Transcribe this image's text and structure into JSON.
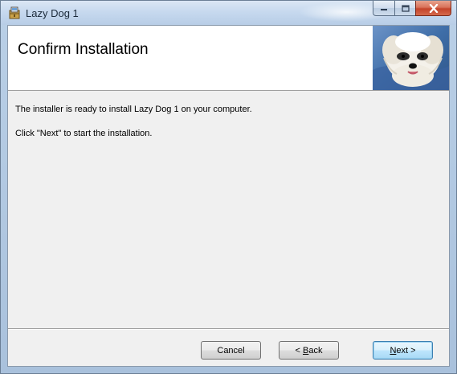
{
  "window": {
    "title": "Lazy Dog 1"
  },
  "caption_buttons": {
    "minimize_icon": "minimize-icon",
    "maximize_icon": "maximize-icon",
    "close_icon": "close-icon"
  },
  "banner": {
    "title": "Confirm Installation",
    "image": "dog-illustration"
  },
  "body": {
    "line1": "The installer is ready to install Lazy Dog 1 on your computer.",
    "line2": "Click \"Next\" to start the installation."
  },
  "buttons": {
    "cancel_label": "Cancel",
    "back_prefix": "< ",
    "back_mnemonic": "B",
    "back_rest": "ack",
    "next_mnemonic": "N",
    "next_rest": "ext >"
  },
  "colors": {
    "close_button": "#c4432a",
    "default_button_border": "#3c7fb1",
    "client_background": "#f0f0f0"
  }
}
